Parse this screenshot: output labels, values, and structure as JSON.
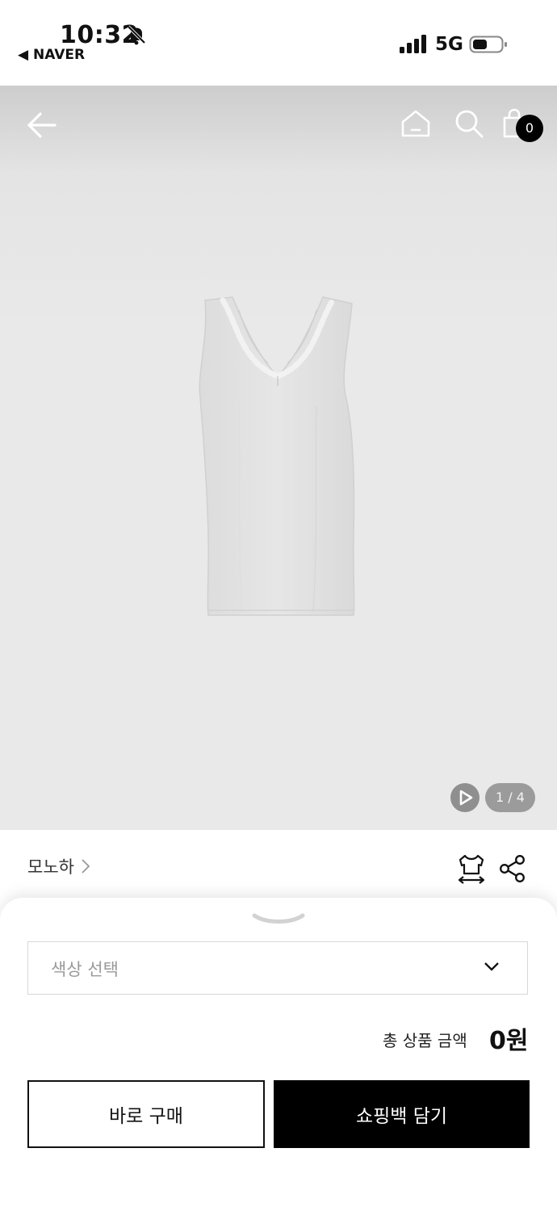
{
  "status_bar": {
    "time": "10:32",
    "back_app": "◀ NAVER",
    "network": "5G"
  },
  "header": {
    "bag_count": "0"
  },
  "gallery": {
    "counter": "1 / 4"
  },
  "brand": {
    "name": "모노하"
  },
  "sheet": {
    "color_select_placeholder": "색상 선택",
    "total_label": "총 상품 금액",
    "total_value": "0원",
    "buy_now_label": "바로 구매",
    "add_to_bag_label": "쇼핑백 담기"
  },
  "colors": {
    "primary_button": "#000000",
    "image_background": "#e9e9e9"
  },
  "icons": [
    "bell-slash-icon",
    "signal-icon",
    "battery-icon",
    "back-arrow-icon",
    "home-icon",
    "search-icon",
    "shopping-bag-icon",
    "play-icon",
    "chevron-right-icon",
    "size-guide-icon",
    "share-icon",
    "chevron-down-icon"
  ]
}
